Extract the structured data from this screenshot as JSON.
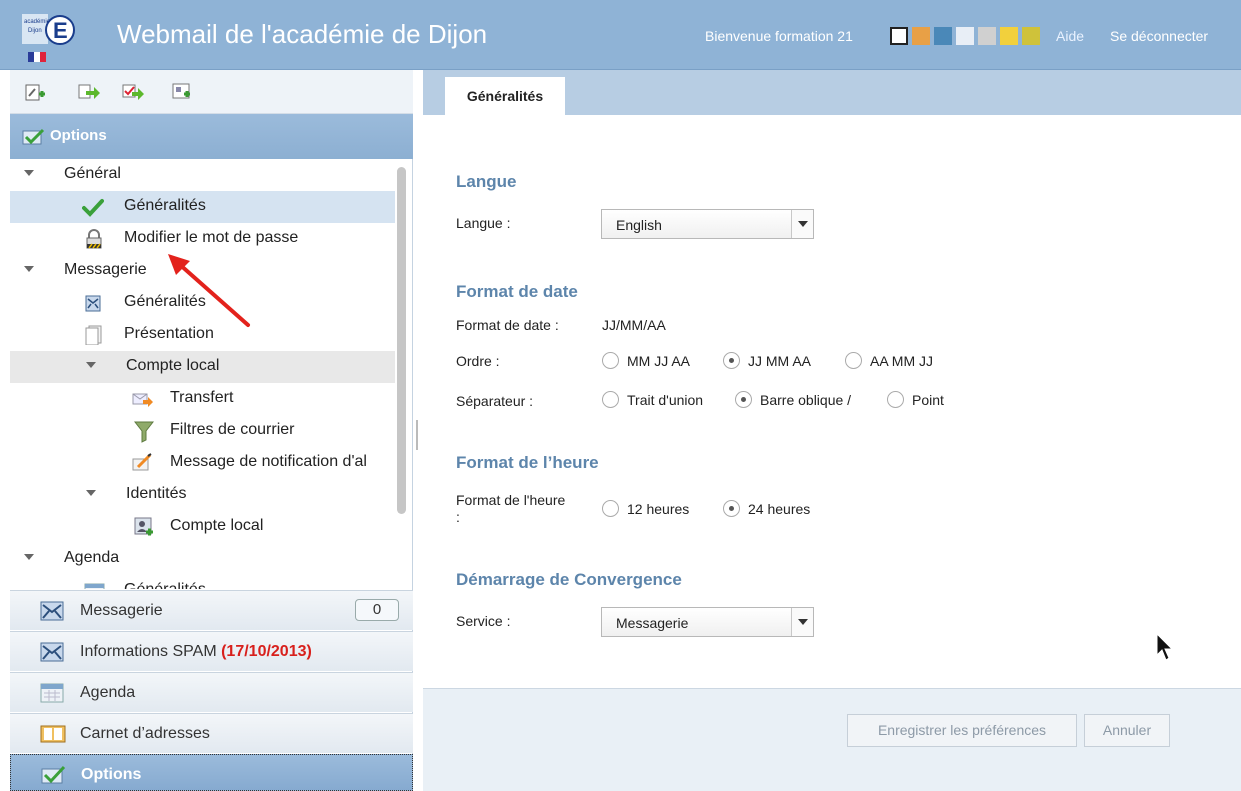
{
  "header": {
    "logo_lines": [
      "académie",
      "Dijon"
    ],
    "logo_letter": "E",
    "title": "Webmail de l'académie de Dijon",
    "welcome": "Bienvenue formation 21",
    "theme_colors": [
      "#ffffff",
      "#e8a046",
      "#4a88b8",
      "#e8eef6",
      "#d0d0d0",
      "#f2d03c",
      "#cfc23a"
    ],
    "help": "Aide",
    "logout": "Se déconnecter"
  },
  "left_panel": {
    "toolbar_icons": [
      "new-item-icon",
      "move-icon",
      "move-check-icon",
      "import-icon"
    ],
    "section_title": "Options",
    "tree": [
      {
        "label": "Général",
        "type": "group"
      },
      {
        "label": "Généralités",
        "type": "item",
        "icon": "check-icon",
        "selected": true
      },
      {
        "label": "Modifier le mot de passe",
        "type": "item",
        "icon": "lock-icon"
      },
      {
        "label": "Messagerie",
        "type": "group"
      },
      {
        "label": "Généralités",
        "type": "item",
        "icon": "mail-icon"
      },
      {
        "label": "Présentation",
        "type": "item",
        "icon": "document-icon"
      },
      {
        "label": "Compte local",
        "type": "subgroup"
      },
      {
        "label": "Transfert",
        "type": "subitem",
        "icon": "forward-icon"
      },
      {
        "label": "Filtres de courrier",
        "type": "subitem",
        "icon": "filter-icon"
      },
      {
        "label": "Message de notification d'al",
        "type": "subitem",
        "icon": "notification-icon"
      },
      {
        "label": "Identités",
        "type": "subgroup"
      },
      {
        "label": "Compte local",
        "type": "subitem",
        "icon": "identity-icon"
      },
      {
        "label": "Agenda",
        "type": "group"
      },
      {
        "label": "Généralités",
        "type": "item",
        "icon": "calendar-icon"
      }
    ],
    "accordion": {
      "messagerie": "Messagerie",
      "messagerie_count": "0",
      "spam": "Informations SPAM",
      "spam_date": "(17/10/2013)",
      "agenda": "Agenda",
      "carnet": "Carnet d’adresses",
      "options": "Options"
    }
  },
  "main": {
    "tab": "Généralités",
    "langue": {
      "section": "Langue",
      "label": "Langue :",
      "value": "English"
    },
    "date_format": {
      "section": "Format de date",
      "format_label": "Format de date :",
      "format_value": "JJ/MM/AA",
      "order_label": "Ordre :",
      "order_options": [
        "MM JJ AA",
        "JJ MM AA",
        "AA MM JJ"
      ],
      "order_selected": 1,
      "separator_label": "Séparateur :",
      "separator_options": [
        "Trait d'union",
        "Barre oblique /",
        "Point"
      ],
      "separator_selected": 1
    },
    "time_format": {
      "section": "Format de l’heure",
      "label_line1": "Format de l'heure",
      "label_line2": ":",
      "options": [
        "12 heures",
        "24 heures"
      ],
      "selected": 1
    },
    "startup": {
      "section": "Démarrage de Convergence",
      "label": "Service :",
      "value": "Messagerie"
    },
    "buttons": {
      "save": "Enregistrer les préférences",
      "cancel": "Annuler"
    }
  }
}
